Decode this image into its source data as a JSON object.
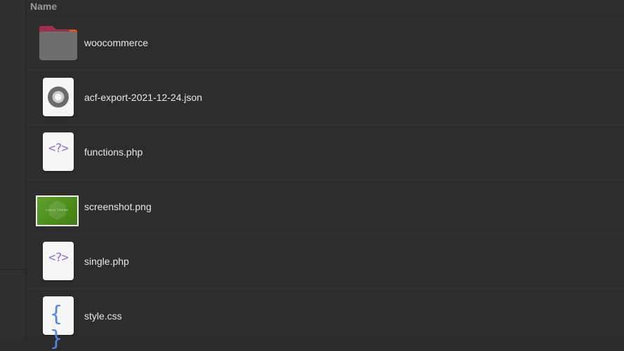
{
  "list": {
    "column_name": "Name",
    "rows": [
      {
        "name": "woocommerce",
        "icon": "folder-icon"
      },
      {
        "name": "acf-export-2021-12-24.json",
        "icon": "json-file-icon"
      },
      {
        "name": "functions.php",
        "icon": "php-file-icon",
        "glyph": "<?>"
      },
      {
        "name": "screenshot.png",
        "icon": "image-thumbnail",
        "thumb_text": "CHILD THEME"
      },
      {
        "name": "single.php",
        "icon": "php-file-icon",
        "glyph": "<?>"
      },
      {
        "name": "style.css",
        "icon": "css-file-icon",
        "glyph": "{ }"
      }
    ]
  },
  "colors": {
    "background": "#2d2d2d",
    "text": "#e8e8e8",
    "header_text": "#9a9a9a",
    "folder_body": "#6e6e6e",
    "folder_tab": "#a02f4f",
    "php_glyph": "#8f6fd6",
    "css_glyph": "#4f86e8",
    "thumb_green": "#5fa12a"
  }
}
